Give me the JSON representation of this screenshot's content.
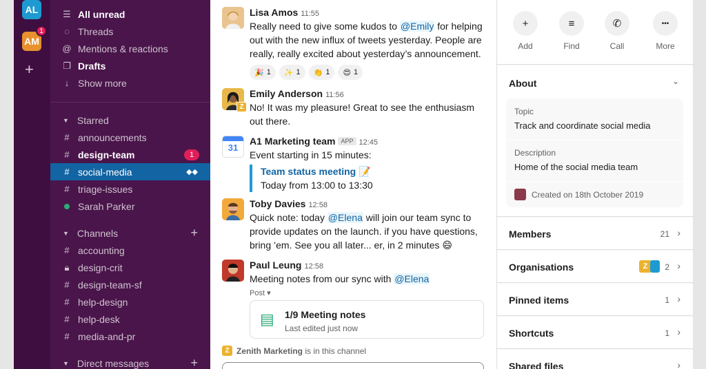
{
  "workspaces": [
    {
      "initials": "AL",
      "color": "#1d9bd1"
    },
    {
      "initials": "AM",
      "color": "#e8912d",
      "badge": "1"
    }
  ],
  "sidebar": {
    "top_items": [
      {
        "label": "All unread",
        "icon": "list-icon",
        "bold": true
      },
      {
        "label": "Threads",
        "icon": "threads-icon"
      },
      {
        "label": "Mentions & reactions",
        "icon": "at-icon"
      },
      {
        "label": "Drafts",
        "icon": "drafts-icon",
        "bold": true
      },
      {
        "label": "Show more",
        "icon": "arrow-down-icon"
      }
    ],
    "starred": {
      "title": "Starred",
      "items": [
        {
          "label": "announcements",
          "prefix": "#"
        },
        {
          "label": "design-team",
          "prefix": "#",
          "bold": true,
          "badge": "1"
        },
        {
          "label": "social-media",
          "prefix": "#",
          "active": true
        },
        {
          "label": "triage-issues",
          "prefix": "#"
        },
        {
          "label": "Sarah Parker",
          "prefix": "online-dot"
        }
      ]
    },
    "channels": {
      "title": "Channels",
      "items": [
        {
          "label": "accounting",
          "prefix": "#"
        },
        {
          "label": "design-crit",
          "prefix": "lock"
        },
        {
          "label": "design-team-sf",
          "prefix": "#"
        },
        {
          "label": "help-design",
          "prefix": "#"
        },
        {
          "label": "help-desk",
          "prefix": "#"
        },
        {
          "label": "media-and-pr",
          "prefix": "#"
        }
      ]
    },
    "dms_title": "Direct messages"
  },
  "messages": [
    {
      "author": "Lisa Amos",
      "time": "11:55",
      "text_parts": [
        "Really need to give some kudos to ",
        "@Emily",
        " for helping out with the new influx of tweets yesterday. People are really, really excited about yesterday’s announcement."
      ],
      "reactions": [
        {
          "emoji": "🎉",
          "count": "1"
        },
        {
          "emoji": "✨",
          "count": "1"
        },
        {
          "emoji": "👏",
          "count": "1"
        },
        {
          "emoji": "😍",
          "count": "1"
        }
      ]
    },
    {
      "author": "Emily Anderson",
      "time": "11:56",
      "text": "No! It was my pleasure! Great to see the enthusiasm out there."
    },
    {
      "author": "A1 Marketing team",
      "app_tag": "APP",
      "time": "12:45",
      "text": "Event starting in 15 minutes:",
      "event_title": "Team status meeting 📝",
      "event_time": "Today from 13:00 to 13:30",
      "calendar_day": "31"
    },
    {
      "author": "Toby Davies",
      "time": "12:58",
      "text_parts": [
        "Quick note: today ",
        "@Elena",
        " will join our team sync to provide updates on the launch. if you have questions, bring ’em. See you all later... er, in 2 minutes 😄"
      ]
    },
    {
      "author": "Paul Leung",
      "time": "12:58",
      "text_parts": [
        "Meeting notes from our sync with ",
        "@Elena"
      ],
      "post_label": "Post ▾",
      "post_title": "1/9 Meeting notes",
      "post_subtitle": "Last edited just now"
    }
  ],
  "channel_note": {
    "name": "Zenith Marketing",
    "suffix": " is in this channel",
    "badge": "Z"
  },
  "details": {
    "actions": [
      {
        "label": "Add",
        "icon": "add-person-icon",
        "glyph": "+"
      },
      {
        "label": "Find",
        "icon": "find-icon",
        "glyph": "≡"
      },
      {
        "label": "Call",
        "icon": "phone-icon",
        "glyph": "✆"
      },
      {
        "label": "More",
        "icon": "more-icon",
        "glyph": "•••"
      }
    ],
    "about_title": "About",
    "topic_label": "Topic",
    "topic_value": "Track and coordinate social media",
    "description_label": "Description",
    "description_value": "Home of the social media team",
    "created": "Created on 18th October 2019",
    "rows": [
      {
        "label": "Members",
        "count": "21"
      },
      {
        "label": "Organisations",
        "count": "2",
        "org_badge": "Z"
      },
      {
        "label": "Pinned items",
        "count": "1"
      },
      {
        "label": "Shortcuts",
        "count": "1"
      },
      {
        "label": "Shared files",
        "count": ""
      }
    ]
  },
  "colors": {
    "sidebar": "#4a154b",
    "rail": "#3f0e40",
    "active": "#1264a3",
    "badge": "#e01e5a",
    "link": "#1264a3"
  }
}
